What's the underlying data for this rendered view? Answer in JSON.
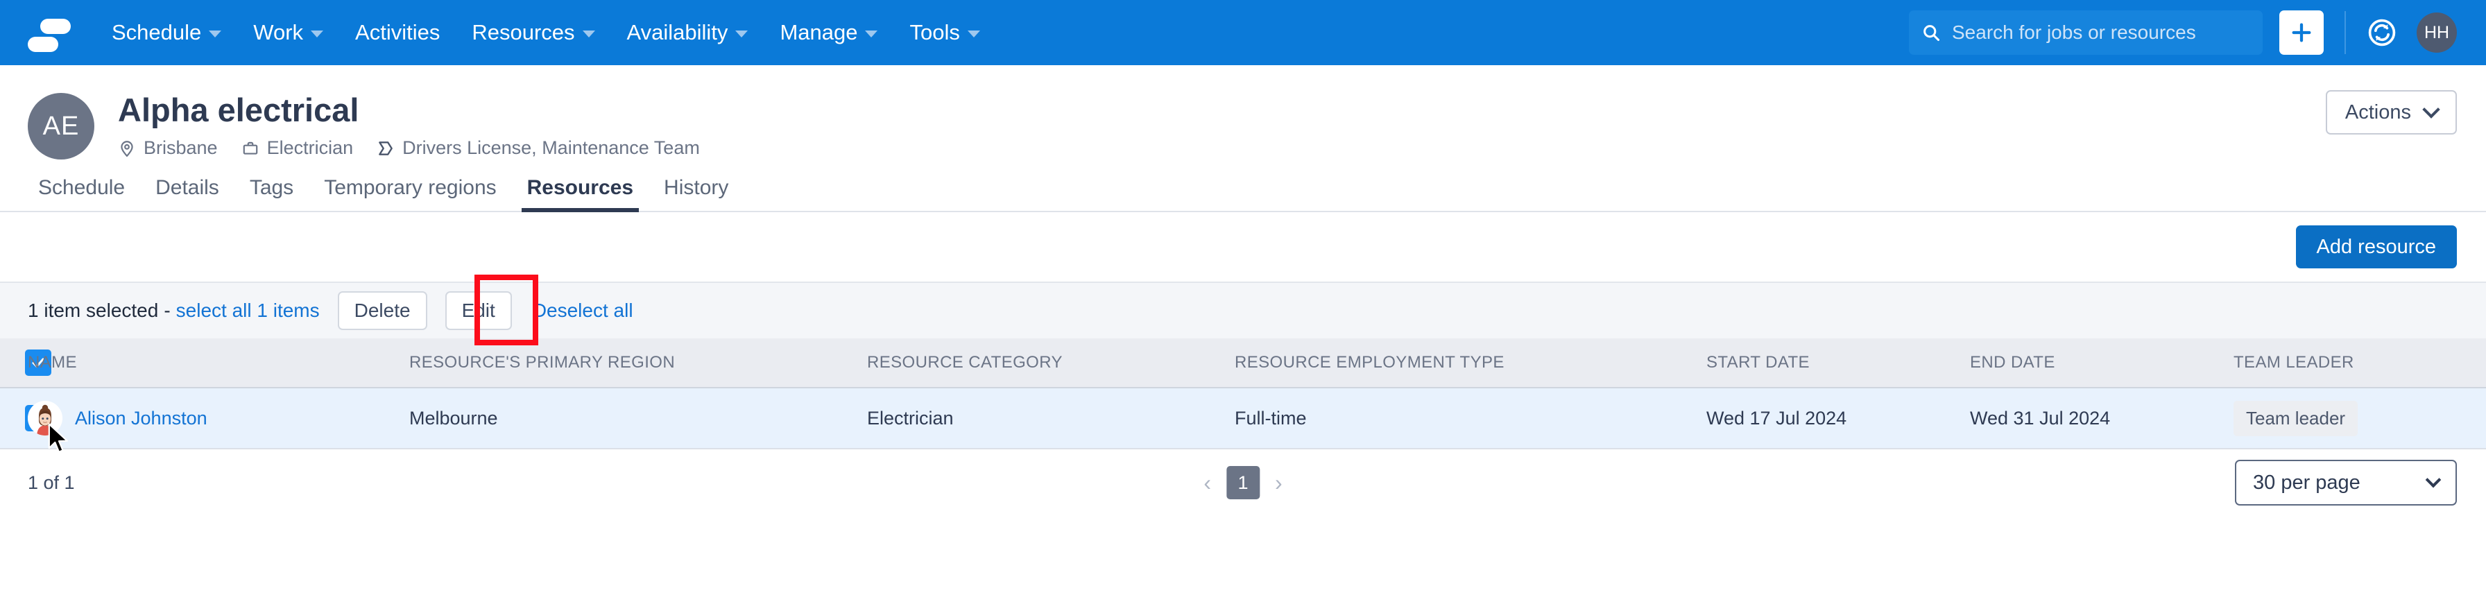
{
  "navbar": {
    "logo_name": "deputy-logo",
    "items": [
      {
        "label": "Schedule",
        "has_caret": true
      },
      {
        "label": "Work",
        "has_caret": true
      },
      {
        "label": "Activities",
        "has_caret": false
      },
      {
        "label": "Resources",
        "has_caret": true
      },
      {
        "label": "Availability",
        "has_caret": true
      },
      {
        "label": "Manage",
        "has_caret": true
      },
      {
        "label": "Tools",
        "has_caret": true
      }
    ],
    "search": {
      "placeholder": "Search for jobs or resources",
      "value": ""
    },
    "add_button_label": "+",
    "refresh_icon": "sync-icon",
    "user_initials": "HH",
    "background_color": "#0b7ad8"
  },
  "page_header": {
    "avatar_initials": "AE",
    "title": "Alpha electrical",
    "meta": [
      {
        "icon": "location-pin-icon",
        "label": "Brisbane"
      },
      {
        "icon": "briefcase-icon",
        "label": "Electrician"
      },
      {
        "icon": "tag-icon",
        "label": "Drivers License, Maintenance Team"
      }
    ],
    "actions_label": "Actions"
  },
  "tabs": [
    {
      "label": "Schedule",
      "active": false
    },
    {
      "label": "Details",
      "active": false
    },
    {
      "label": "Tags",
      "active": false
    },
    {
      "label": "Temporary regions",
      "active": false
    },
    {
      "label": "Resources",
      "active": true
    },
    {
      "label": "History",
      "active": false
    }
  ],
  "action_bar": {
    "add_resource_label": "Add resource"
  },
  "selection_bar": {
    "selected_text": "1 item selected",
    "separator": "-",
    "select_all_label": "select all 1 items",
    "delete_label": "Delete",
    "edit_label": "Edit",
    "deselect_label": "Deselect all",
    "annotation_color": "#fc0d1b",
    "annotated_element": "edit-button"
  },
  "table": {
    "select_all_checked": true,
    "columns": [
      "NAME",
      "RESOURCE'S PRIMARY REGION",
      "RESOURCE CATEGORY",
      "RESOURCE EMPLOYMENT TYPE",
      "START DATE",
      "END DATE",
      "TEAM LEADER"
    ],
    "rows": [
      {
        "checked": true,
        "name": "Alison Johnston",
        "region": "Melbourne",
        "category": "Electrician",
        "employment_type": "Full-time",
        "start_date": "Wed 17 Jul 2024",
        "end_date": "Wed 31 Jul 2024",
        "team_leader": "Team leader"
      }
    ]
  },
  "footer": {
    "count_text": "1 of 1",
    "prev_label": "‹",
    "current_page": "1",
    "next_label": "›",
    "per_page_label": "30 per page"
  }
}
